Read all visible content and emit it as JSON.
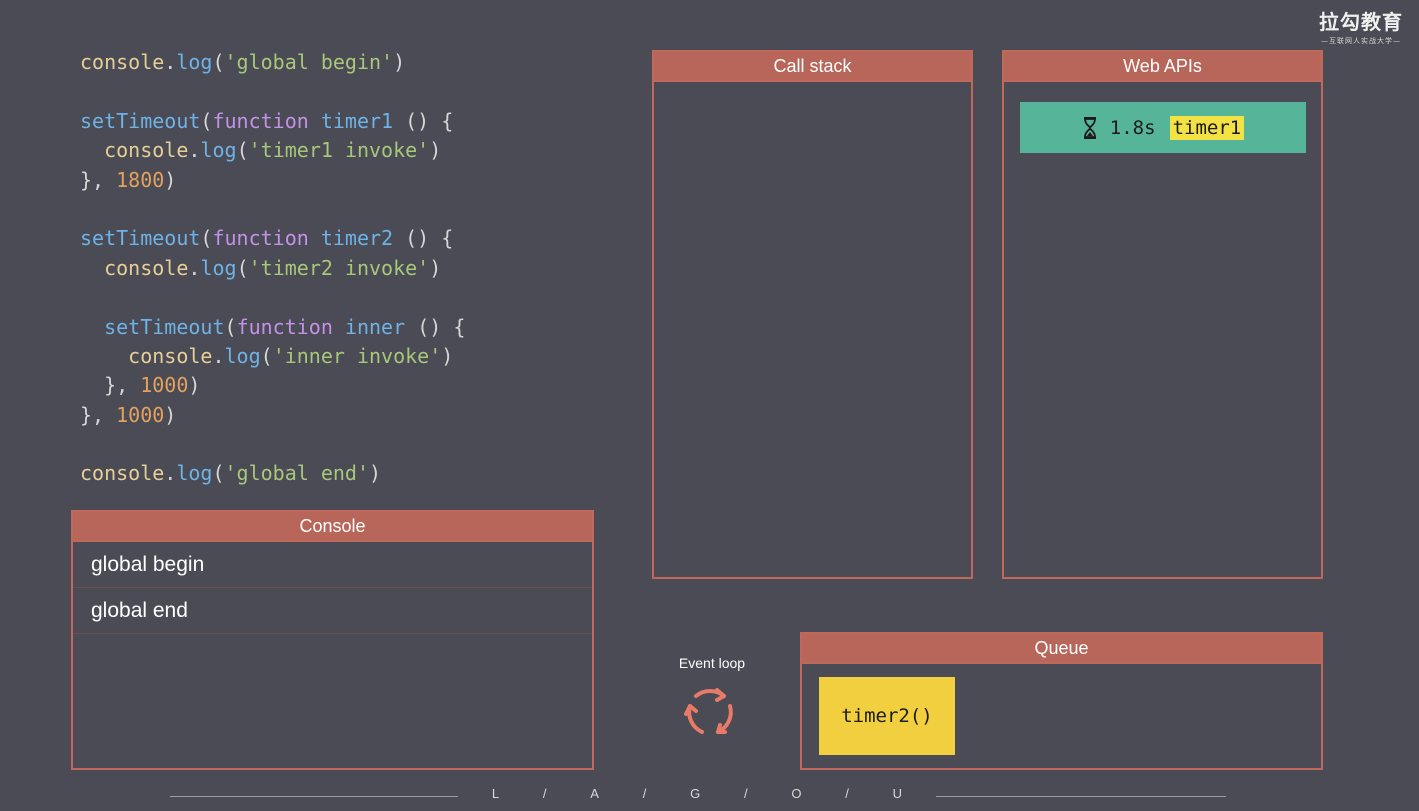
{
  "code": [
    [
      [
        "tok-obj",
        "console"
      ],
      [
        "tok-p",
        "."
      ],
      [
        "tok-fn",
        "log"
      ],
      [
        "tok-p",
        "("
      ],
      [
        "tok-str",
        "'global begin'"
      ],
      [
        "tok-p",
        ")"
      ]
    ],
    [],
    [
      [
        "tok-fn",
        "setTimeout"
      ],
      [
        "tok-p",
        "("
      ],
      [
        "tok-kw",
        "function"
      ],
      [
        "tok-p",
        " "
      ],
      [
        "tok-name",
        "timer1"
      ],
      [
        "tok-p",
        " () {"
      ]
    ],
    [
      [
        "tok-p",
        "  "
      ],
      [
        "tok-obj",
        "console"
      ],
      [
        "tok-p",
        "."
      ],
      [
        "tok-fn",
        "log"
      ],
      [
        "tok-p",
        "("
      ],
      [
        "tok-str",
        "'timer1 invoke'"
      ],
      [
        "tok-p",
        ")"
      ]
    ],
    [
      [
        "tok-p",
        "}, "
      ],
      [
        "tok-num",
        "1800"
      ],
      [
        "tok-p",
        ")"
      ]
    ],
    [],
    [
      [
        "tok-fn",
        "setTimeout"
      ],
      [
        "tok-p",
        "("
      ],
      [
        "tok-kw",
        "function"
      ],
      [
        "tok-p",
        " "
      ],
      [
        "tok-name",
        "timer2"
      ],
      [
        "tok-p",
        " () {"
      ]
    ],
    [
      [
        "tok-p",
        "  "
      ],
      [
        "tok-obj",
        "console"
      ],
      [
        "tok-p",
        "."
      ],
      [
        "tok-fn",
        "log"
      ],
      [
        "tok-p",
        "("
      ],
      [
        "tok-str",
        "'timer2 invoke'"
      ],
      [
        "tok-p",
        ")"
      ]
    ],
    [],
    [
      [
        "tok-p",
        "  "
      ],
      [
        "tok-fn",
        "setTimeout"
      ],
      [
        "tok-p",
        "("
      ],
      [
        "tok-kw",
        "function"
      ],
      [
        "tok-p",
        " "
      ],
      [
        "tok-name",
        "inner"
      ],
      [
        "tok-p",
        " () {"
      ]
    ],
    [
      [
        "tok-p",
        "    "
      ],
      [
        "tok-obj",
        "console"
      ],
      [
        "tok-p",
        "."
      ],
      [
        "tok-fn",
        "log"
      ],
      [
        "tok-p",
        "("
      ],
      [
        "tok-str",
        "'inner invoke'"
      ],
      [
        "tok-p",
        ")"
      ]
    ],
    [
      [
        "tok-p",
        "  }, "
      ],
      [
        "tok-num",
        "1000"
      ],
      [
        "tok-p",
        ")"
      ]
    ],
    [
      [
        "tok-p",
        "}, "
      ],
      [
        "tok-num",
        "1000"
      ],
      [
        "tok-p",
        ")"
      ]
    ],
    [],
    [
      [
        "tok-obj",
        "console"
      ],
      [
        "tok-p",
        "."
      ],
      [
        "tok-fn",
        "log"
      ],
      [
        "tok-p",
        "("
      ],
      [
        "tok-str",
        "'global end'"
      ],
      [
        "tok-p",
        ")"
      ]
    ]
  ],
  "console": {
    "title": "Console",
    "lines": [
      "global begin",
      "global end"
    ]
  },
  "callstack": {
    "title": "Call stack"
  },
  "webapis": {
    "title": "Web APIs",
    "item": {
      "icon": "hourglass-icon",
      "time": "1.8s",
      "name": "timer1",
      "color": "#56b598",
      "highlight": "#f3e244"
    }
  },
  "queue": {
    "title": "Queue",
    "item": {
      "label": "timer2()",
      "color": "#f2cf3f"
    }
  },
  "event_loop": {
    "label": "Event loop",
    "icon": "refresh-cycle-icon",
    "color": "#e97a68"
  },
  "logo": {
    "main": "拉勾教育",
    "sub": "—互联网人实战大学—"
  },
  "footer": {
    "letters": [
      "L",
      "/",
      "A",
      "/",
      "G",
      "/",
      "O",
      "/",
      "U"
    ]
  },
  "colors": {
    "background": "#4a4b55",
    "panel_border": "#c0685a",
    "panel_header": "#b8655a"
  }
}
